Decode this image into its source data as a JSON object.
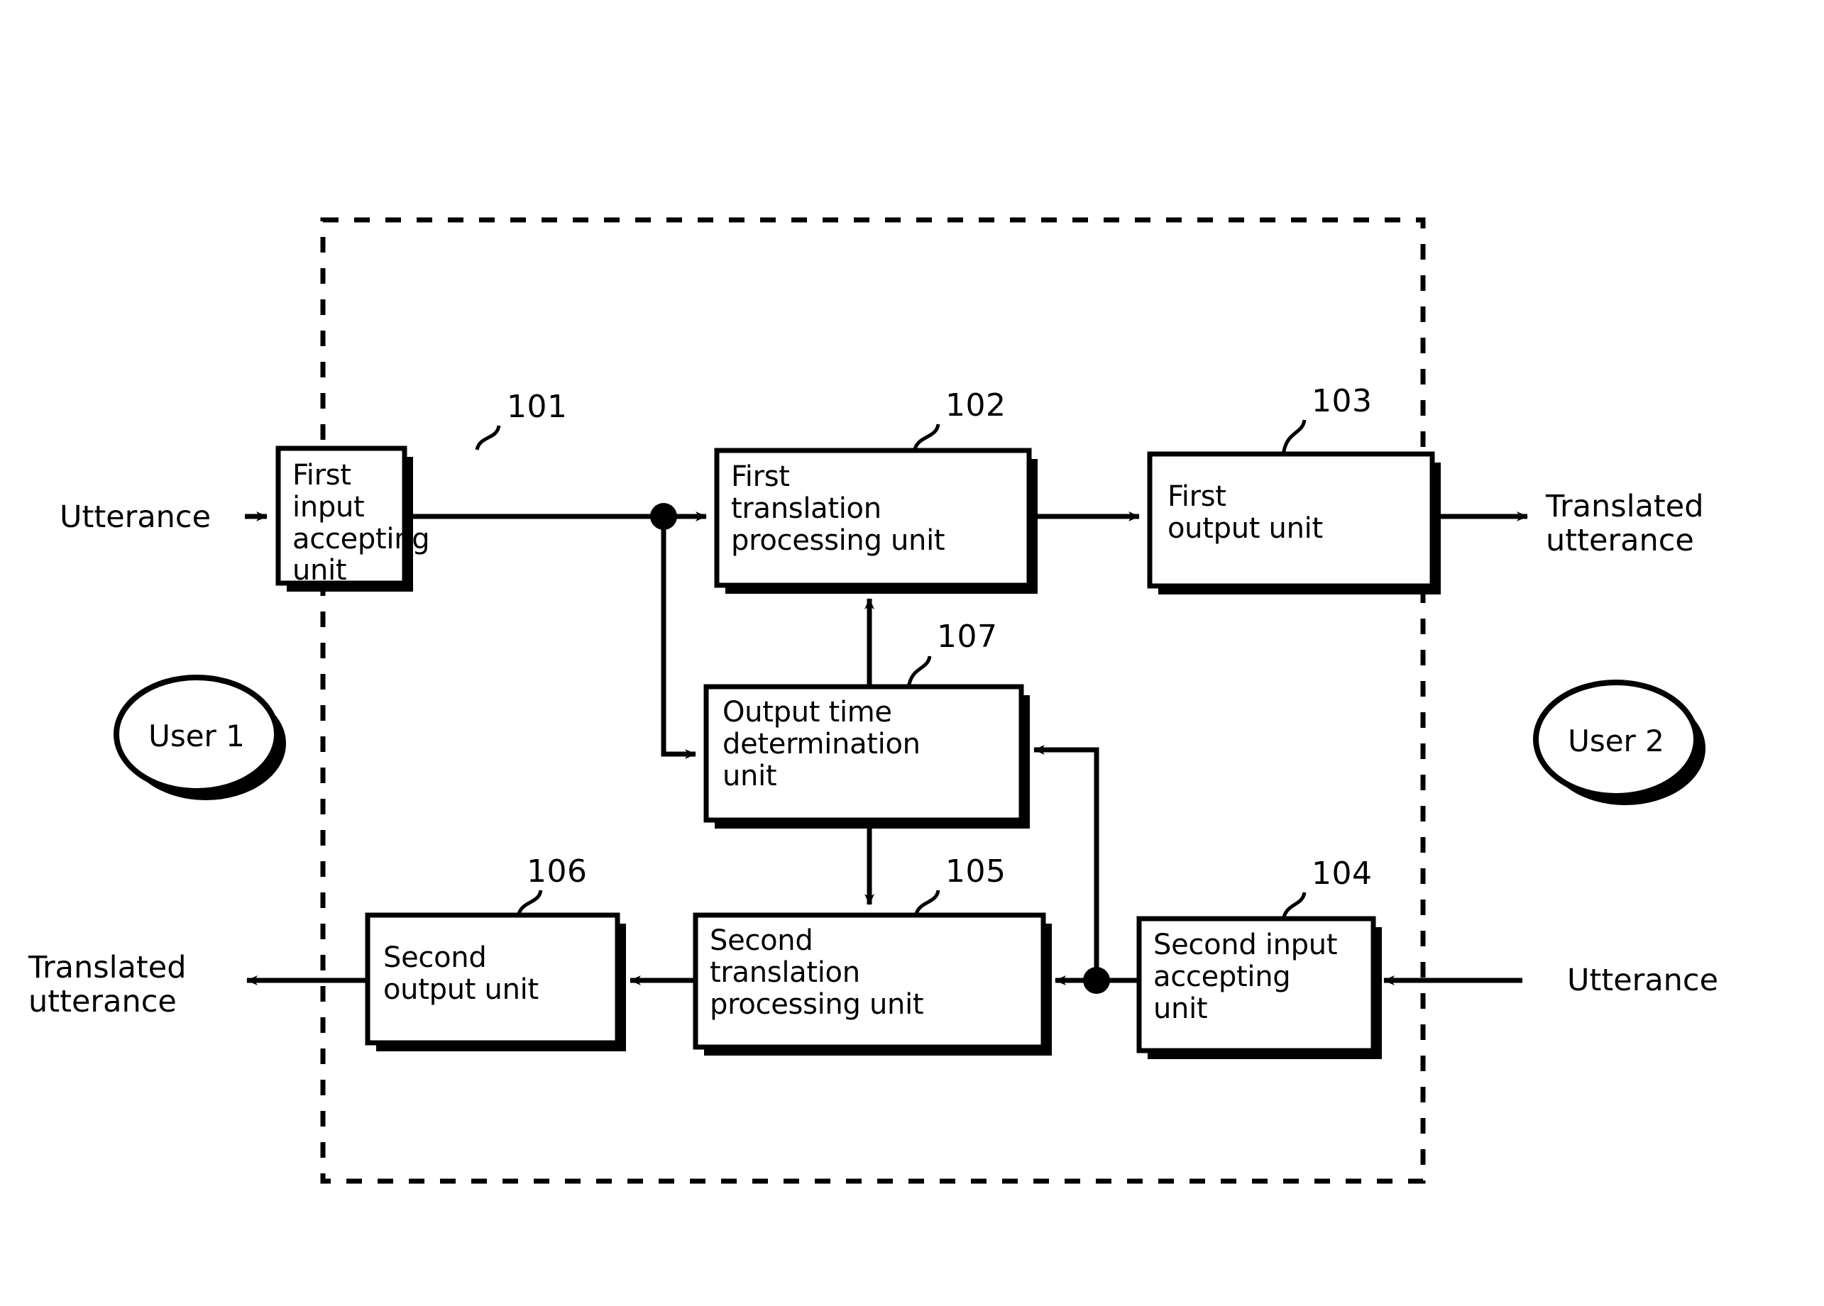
{
  "figure": {
    "type": "block-diagram",
    "description": "Speech translation apparatus block diagram",
    "boundary": {
      "style": "dashed",
      "label": ""
    }
  },
  "blocks": [
    {
      "id": "101",
      "label": "First input\naccepting\nunit",
      "ref": "101"
    },
    {
      "id": "102",
      "label": "First\ntranslation\nprocessing unit",
      "ref": "102"
    },
    {
      "id": "103",
      "label": "First\noutput unit",
      "ref": "103"
    },
    {
      "id": "107",
      "label": "Output time\ndetermination\nunit",
      "ref": "107"
    },
    {
      "id": "106",
      "label": "Second\noutput unit",
      "ref": "106"
    },
    {
      "id": "105",
      "label": "Second\ntranslation\nprocessing unit",
      "ref": "105"
    },
    {
      "id": "104",
      "label": "Second input\naccepting\nunit",
      "ref": "104"
    }
  ],
  "actors": [
    {
      "id": "user1",
      "label": "User 1"
    },
    {
      "id": "user2",
      "label": "User 2"
    }
  ],
  "external_labels": {
    "input_left": "Utterance",
    "output_right": "Translated\nutterance",
    "output_left": "Translated\nutterance",
    "input_right": "Utterance"
  },
  "colors": {
    "stroke": "#000000",
    "fill": "#ffffff",
    "shadow": "#000000",
    "background": "#ffffff"
  }
}
